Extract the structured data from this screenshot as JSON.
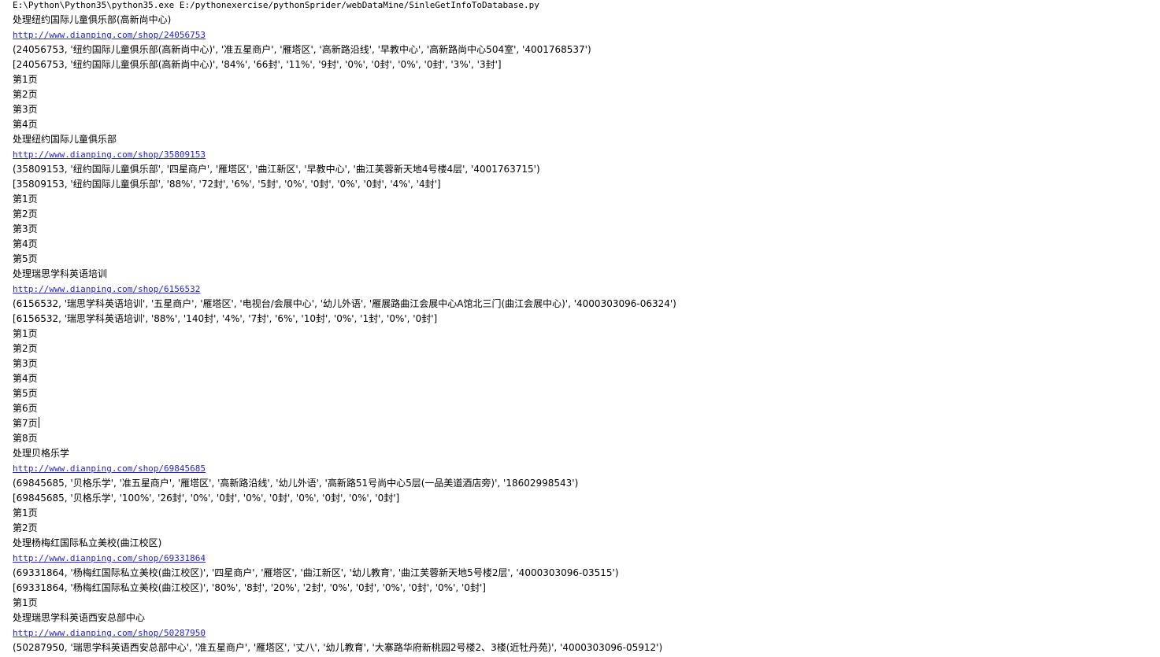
{
  "console": {
    "lines": [
      {
        "type": "cmd",
        "text": "E:\\Python\\Python35\\python35.exe E:/pythonexercise/pythonSprider/webDataMine/SinleGetInfoToDatabase.py"
      },
      {
        "type": "text",
        "text": "处理纽约国际儿童俱乐部(高新尚中心)"
      },
      {
        "type": "link",
        "text": "http://www.dianping.com/shop/24056753"
      },
      {
        "type": "text",
        "text": "(24056753, '纽约国际儿童俱乐部(高新尚中心)', '准五星商户', '雁塔区', '高新路沿线', '早教中心', '高新路尚中心504室', '4001768537')"
      },
      {
        "type": "text",
        "text": "[24056753, '纽约国际儿童俱乐部(高新尚中心)', '84%', '66封', '11%', '9封', '0%', '0封', '0%', '0封', '3%', '3封']"
      },
      {
        "type": "text",
        "text": "第1页"
      },
      {
        "type": "text",
        "text": "第2页"
      },
      {
        "type": "text",
        "text": "第3页"
      },
      {
        "type": "text",
        "text": "第4页"
      },
      {
        "type": "text",
        "text": "处理纽约国际儿童俱乐部"
      },
      {
        "type": "link",
        "text": "http://www.dianping.com/shop/35809153"
      },
      {
        "type": "text",
        "text": "(35809153, '纽约国际儿童俱乐部', '四星商户', '雁塔区', '曲江新区', '早教中心', '曲江芙蓉新天地4号楼4层', '4001763715')"
      },
      {
        "type": "text",
        "text": "[35809153, '纽约国际儿童俱乐部', '88%', '72封', '6%', '5封', '0%', '0封', '0%', '0封', '4%', '4封']"
      },
      {
        "type": "text",
        "text": "第1页"
      },
      {
        "type": "text",
        "text": "第2页"
      },
      {
        "type": "text",
        "text": "第3页"
      },
      {
        "type": "text",
        "text": "第4页"
      },
      {
        "type": "text",
        "text": "第5页"
      },
      {
        "type": "text",
        "text": "处理瑞思学科英语培训"
      },
      {
        "type": "link",
        "text": "http://www.dianping.com/shop/6156532"
      },
      {
        "type": "text",
        "text": "(6156532, '瑞思学科英语培训', '五星商户', '雁塔区', '电视台/会展中心', '幼儿外语', '雁展路曲江会展中心A馆北三门(曲江会展中心)', '4000303096-06324')"
      },
      {
        "type": "text",
        "text": "[6156532, '瑞思学科英语培训', '88%', '140封', '4%', '7封', '6%', '10封', '0%', '1封', '0%', '0封']"
      },
      {
        "type": "text",
        "text": "第1页"
      },
      {
        "type": "text",
        "text": "第2页"
      },
      {
        "type": "text",
        "text": "第3页"
      },
      {
        "type": "text",
        "text": "第4页"
      },
      {
        "type": "text",
        "text": "第5页"
      },
      {
        "type": "text",
        "text": "第6页"
      },
      {
        "type": "caret",
        "text": "第7页"
      },
      {
        "type": "text",
        "text": "第8页"
      },
      {
        "type": "text",
        "text": "处理贝格乐学"
      },
      {
        "type": "link",
        "text": "http://www.dianping.com/shop/69845685"
      },
      {
        "type": "text",
        "text": "(69845685, '贝格乐学', '准五星商户', '雁塔区', '高新路沿线', '幼儿外语', '高新路51号尚中心5层(一品美道酒店旁)', '18602998543')"
      },
      {
        "type": "text",
        "text": "[69845685, '贝格乐学', '100%', '26封', '0%', '0封', '0%', '0封', '0%', '0封', '0%', '0封']"
      },
      {
        "type": "text",
        "text": "第1页"
      },
      {
        "type": "text",
        "text": "第2页"
      },
      {
        "type": "text",
        "text": "处理杨梅红国际私立美校(曲江校区)"
      },
      {
        "type": "link",
        "text": "http://www.dianping.com/shop/69331864"
      },
      {
        "type": "text",
        "text": "(69331864, '杨梅红国际私立美校(曲江校区)', '四星商户', '雁塔区', '曲江新区', '幼儿教育', '曲江芙蓉新天地5号楼2层', '4000303096-03515')"
      },
      {
        "type": "text",
        "text": "[69331864, '杨梅红国际私立美校(曲江校区)', '80%', '8封', '20%', '2封', '0%', '0封', '0%', '0封', '0%', '0封']"
      },
      {
        "type": "text",
        "text": "第1页"
      },
      {
        "type": "text",
        "text": "处理瑞思学科英语西安总部中心"
      },
      {
        "type": "link",
        "text": "http://www.dianping.com/shop/50287950"
      },
      {
        "type": "text",
        "text": "(50287950, '瑞思学科英语西安总部中心', '准五星商户', '雁塔区', '丈八', '幼儿教育', '大寨路华府新桃园2号楼2、3楼(近牡丹苑)', '4000303096-05912')"
      }
    ]
  }
}
